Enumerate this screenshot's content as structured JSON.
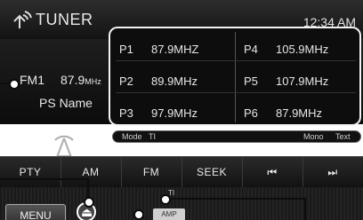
{
  "header": {
    "title": "TUNER",
    "clock": "12:34 AM",
    "icon": "satellite-antenna-icon"
  },
  "station": {
    "band": "FM1",
    "frequency": "87.9",
    "frequency_unit": "MHz",
    "ps_name": "PS Name"
  },
  "presets": [
    {
      "num": "P1",
      "freq": "87.9MHZ"
    },
    {
      "num": "P2",
      "freq": "89.9MHz"
    },
    {
      "num": "P3",
      "freq": "97.9MHz"
    },
    {
      "num": "P4",
      "freq": "105.9MHz"
    },
    {
      "num": "P5",
      "freq": "107.9MHz"
    },
    {
      "num": "P6",
      "freq": "87.9MHz"
    }
  ],
  "modebar": {
    "mode": "Mode",
    "ti": "TI",
    "mono": "Mono",
    "text": "Text"
  },
  "buttons": {
    "pty": "PTY",
    "am": "AM",
    "fm": "FM",
    "seek": "SEEK",
    "prev": "⏮",
    "next": "⏭"
  },
  "bottom": {
    "menu": "MENU",
    "ti": "TI",
    "indicator": "AMP"
  },
  "colors": {
    "background": "#121212",
    "accent": "#ffffff"
  }
}
